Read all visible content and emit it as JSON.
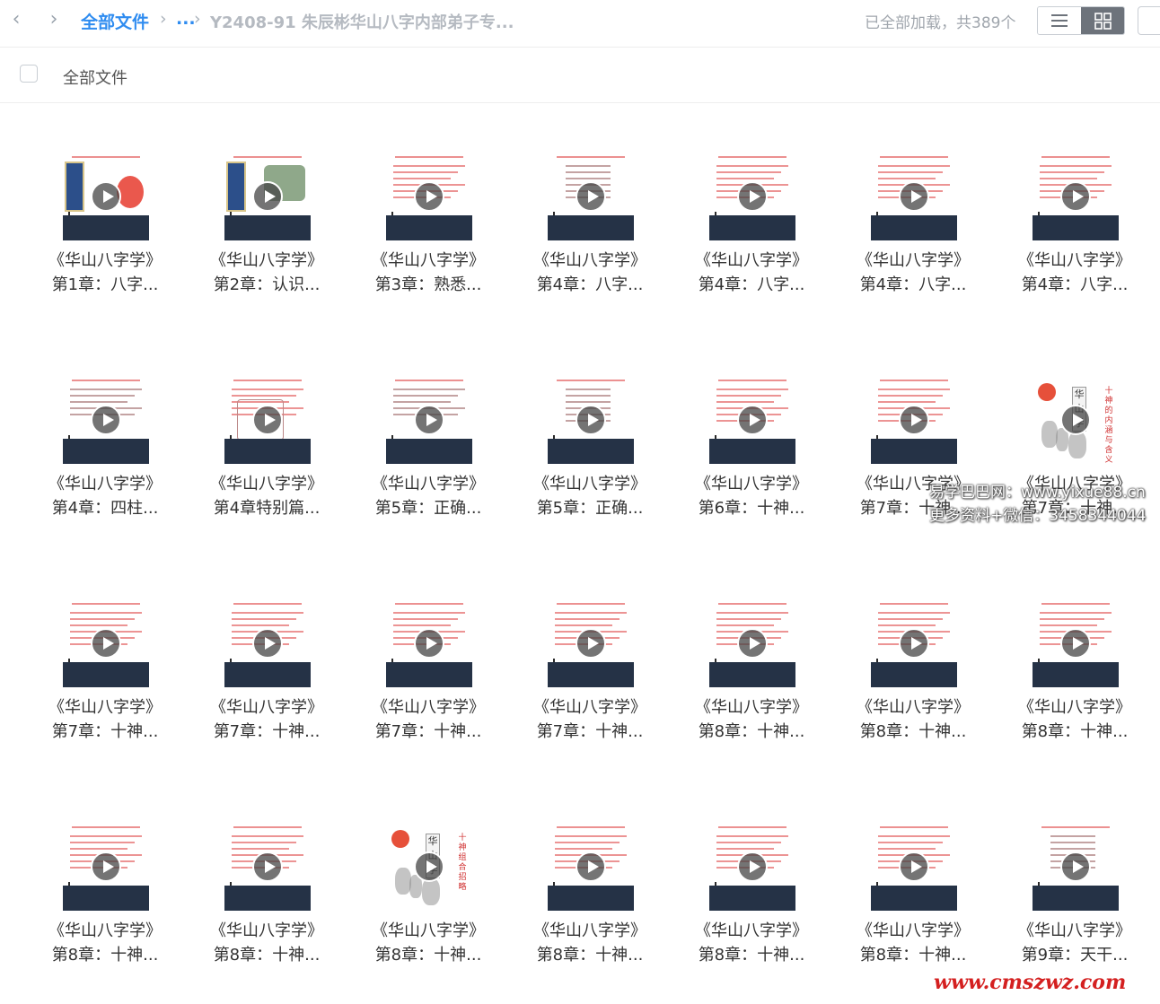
{
  "toolbar": {
    "back_label": "‹",
    "forward_label": "›",
    "root_crumb": "全部文件",
    "sep": "›",
    "more_crumb": "...",
    "current_folder": "Y2408-91 朱辰彬华山八字内部弟子专...",
    "status": "已全部加载，共389个",
    "icons": {
      "back": "chevron-left-icon",
      "forward": "chevron-right-icon",
      "list": "list-view-icon",
      "grid": "grid-view-icon"
    }
  },
  "header": {
    "all_files_label": "全部文件"
  },
  "files": [
    {
      "title": "《华山八字学》",
      "sub": "第1章：八字...",
      "variant": "a"
    },
    {
      "title": "《华山八字学》",
      "sub": "第2章：认识...",
      "variant": "b"
    },
    {
      "title": "《华山八字学》",
      "sub": "第3章：熟悉...",
      "variant": "c"
    },
    {
      "title": "《华山八字学》",
      "sub": "第4章：八字...",
      "variant": "d"
    },
    {
      "title": "《华山八字学》",
      "sub": "第4章：八字...",
      "variant": "c"
    },
    {
      "title": "《华山八字学》",
      "sub": "第4章：八字...",
      "variant": "c"
    },
    {
      "title": "《华山八字学》",
      "sub": "第4章：八字...",
      "variant": "c"
    },
    {
      "title": "《华山八字学》",
      "sub": "第4章：四柱...",
      "variant": "e"
    },
    {
      "title": "《华山八字学》",
      "sub": "第4章特别篇...",
      "variant": "f"
    },
    {
      "title": "《华山八字学》",
      "sub": "第5章：正确...",
      "variant": "e"
    },
    {
      "title": "《华山八字学》",
      "sub": "第5章：正确...",
      "variant": "d"
    },
    {
      "title": "《华山八字学》",
      "sub": "第6章：十神...",
      "variant": "c"
    },
    {
      "title": "《华山八字学》",
      "sub": "第7章：十神...",
      "variant": "g"
    },
    {
      "title": "《华山八字学》",
      "sub": "第7章：十神...",
      "variant": "h"
    },
    {
      "title": "《华山八字学》",
      "sub": "第7章：十神...",
      "variant": "i"
    },
    {
      "title": "《华山八字学》",
      "sub": "第7章：十神...",
      "variant": "i"
    },
    {
      "title": "《华山八字学》",
      "sub": "第7章：十神...",
      "variant": "i"
    },
    {
      "title": "《华山八字学》",
      "sub": "第7章：十神...",
      "variant": "i"
    },
    {
      "title": "《华山八字学》",
      "sub": "第8章：十神...",
      "variant": "i"
    },
    {
      "title": "《华山八字学》",
      "sub": "第8章：十神...",
      "variant": "i"
    },
    {
      "title": "《华山八字学》",
      "sub": "第8章：十神...",
      "variant": "i"
    },
    {
      "title": "《华山八字学》",
      "sub": "第8章：十神...",
      "variant": "i"
    },
    {
      "title": "《华山八字学》",
      "sub": "第8章：十神...",
      "variant": "i"
    },
    {
      "title": "《华山八字学》",
      "sub": "第8章：十神...",
      "variant": "h2"
    },
    {
      "title": "《华山八字学》",
      "sub": "第8章：十神...",
      "variant": "i"
    },
    {
      "title": "《华山八字学》",
      "sub": "第8章：十神...",
      "variant": "i"
    },
    {
      "title": "《华山八字学》",
      "sub": "第8章：十神...",
      "variant": "i"
    },
    {
      "title": "《华山八字学》",
      "sub": "第9章：天干...",
      "variant": "d"
    }
  ],
  "thumb_text": {
    "b2": "华山学",
    "col1": "十神的内涵与含义",
    "col2": "十神组合招略"
  },
  "watermark": {
    "line1": "易学巴巴网：www.yixue88.cn",
    "line2": "更多资料+微信：3458344044",
    "bottom": "www.cmszwz.com"
  }
}
